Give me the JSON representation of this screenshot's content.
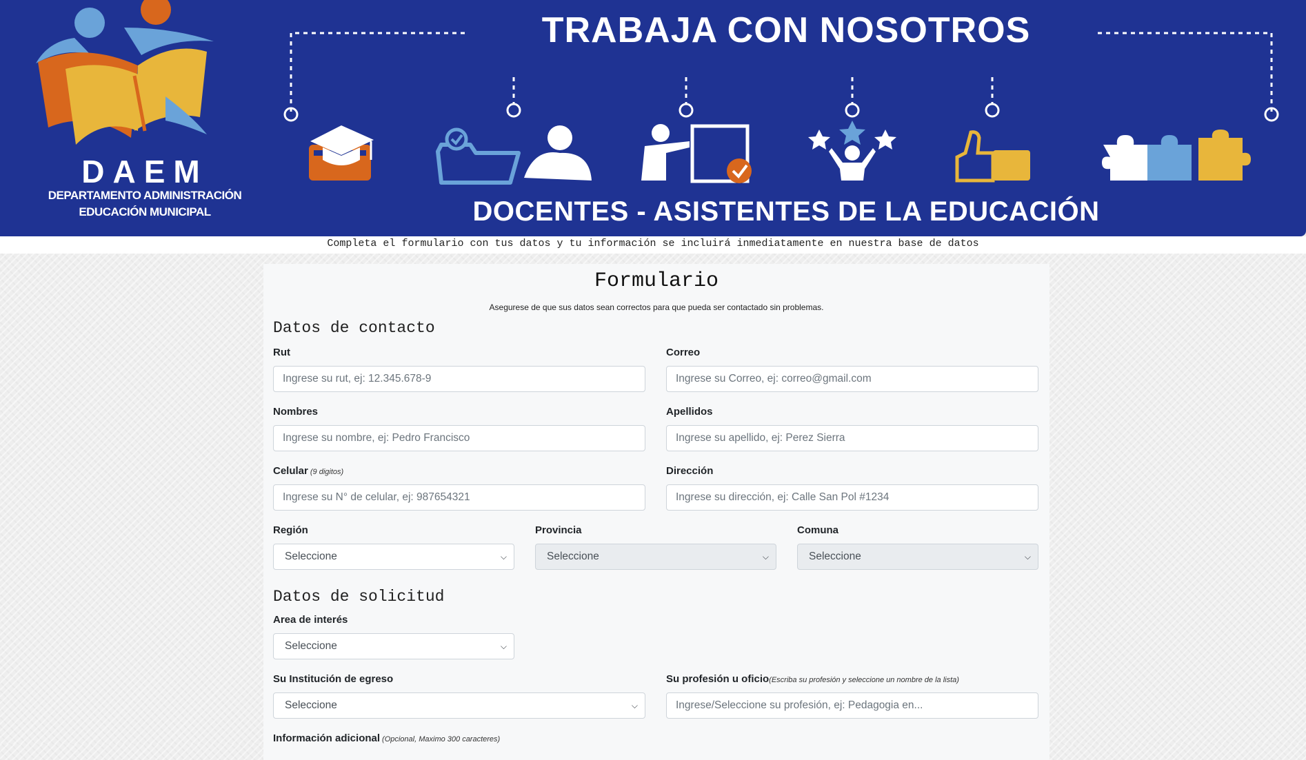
{
  "banner": {
    "title": "TRABAJA CON NOSOTROS",
    "subtitle": "DOCENTES - ASISTENTES DE LA EDUCACIÓN",
    "logo": {
      "name": "DAEM",
      "line1": "DEPARTAMENTO ADMINISTRACIÓN",
      "line2": "EDUCACIÓN MUNICIPAL"
    },
    "icons": [
      "graduation-cap-icon",
      "folder-check-icon",
      "person-icon",
      "teacher-board-icon",
      "stars-person-icon",
      "thumbs-up-icon",
      "puzzle-pieces-icon"
    ],
    "colors": {
      "background": "#1f3393",
      "accent_orange": "#d8671d",
      "accent_yellow": "#e8b63b",
      "accent_light_blue": "#6aa3d9"
    }
  },
  "intro_text": "Completa el formulario con tus datos y tu información se incluirá inmediatamente en nuestra base de datos",
  "form": {
    "title": "Formulario",
    "subtitle": "Asegurese de que sus datos sean correctos para que pueda ser contactado sin problemas.",
    "contact_section": "Datos de contacto",
    "rut": {
      "label": "Rut",
      "placeholder": "Ingrese su rut, ej: 12.345.678-9"
    },
    "correo": {
      "label": "Correo",
      "placeholder": "Ingrese su Correo, ej: correo@gmail.com"
    },
    "nombres": {
      "label": "Nombres",
      "placeholder": "Ingrese su nombre, ej: Pedro Francisco"
    },
    "apellidos": {
      "label": "Apellidos",
      "placeholder": "Ingrese su apellido, ej: Perez Sierra"
    },
    "celular": {
      "label": "Celular",
      "hint": "(9 digitos)",
      "placeholder": "Ingrese su N° de celular, ej: 987654321"
    },
    "direccion": {
      "label": "Dirección",
      "placeholder": "Ingrese su dirección, ej: Calle San Pol #1234"
    },
    "region": {
      "label": "Región",
      "value": "Seleccione"
    },
    "provincia": {
      "label": "Provincia",
      "value": "Seleccione"
    },
    "comuna": {
      "label": "Comuna",
      "value": "Seleccione"
    },
    "request_section": "Datos de solicitud",
    "area": {
      "label": "Area de interés",
      "value": "Seleccione"
    },
    "institucion": {
      "label": "Su Institución de egreso",
      "value": "Seleccione"
    },
    "profesion": {
      "label": "Su profesión u oficio",
      "hint": "(Escriba su profesión y seleccione un nombre de la lista)",
      "placeholder": "Ingrese/Seleccione su profesión, ej: Pedagogia en..."
    },
    "info_adicional": {
      "label": "Información adicional",
      "hint": "(Opcional, Maximo 300 caracteres)"
    }
  }
}
